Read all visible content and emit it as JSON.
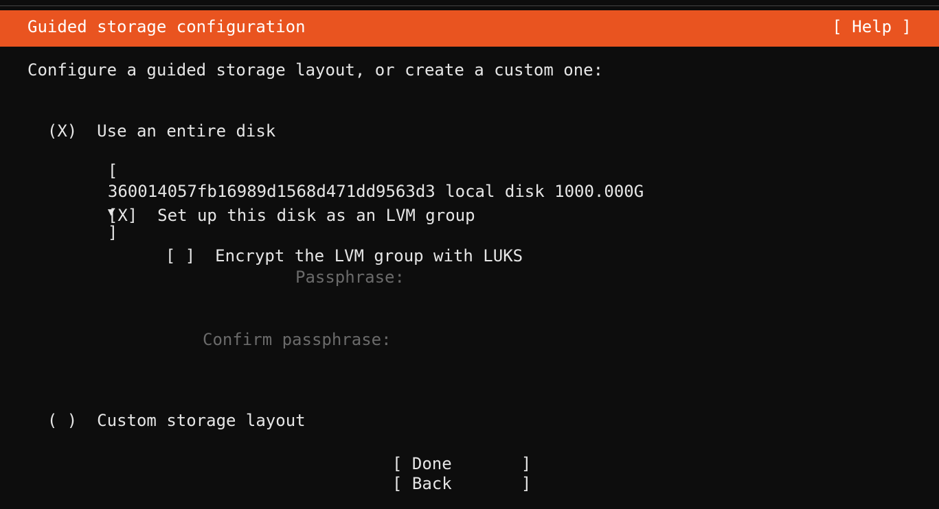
{
  "header": {
    "title": "Guided storage configuration",
    "help": "[ Help ]"
  },
  "intro": "Configure a guided storage layout, or create a custom one:",
  "options": {
    "entire_disk": {
      "marker": "(X)",
      "label": "Use an entire disk"
    },
    "disk_select": {
      "open": "[",
      "value": "360014057fb16989d1568d471dd9563d3 local disk 1000.000G",
      "arrow": "▼",
      "close": "]"
    },
    "lvm": {
      "marker": "[X]",
      "label": "Set up this disk as an LVM group"
    },
    "encrypt": {
      "marker": "[ ]",
      "label": "Encrypt the LVM group with LUKS"
    },
    "passphrase_label": "Passphrase:",
    "confirm_passphrase_label": "Confirm passphrase:",
    "custom": {
      "marker": "( )",
      "label": "Custom storage layout"
    }
  },
  "buttons": {
    "done": "[ Done       ]",
    "back": "[ Back       ]"
  }
}
